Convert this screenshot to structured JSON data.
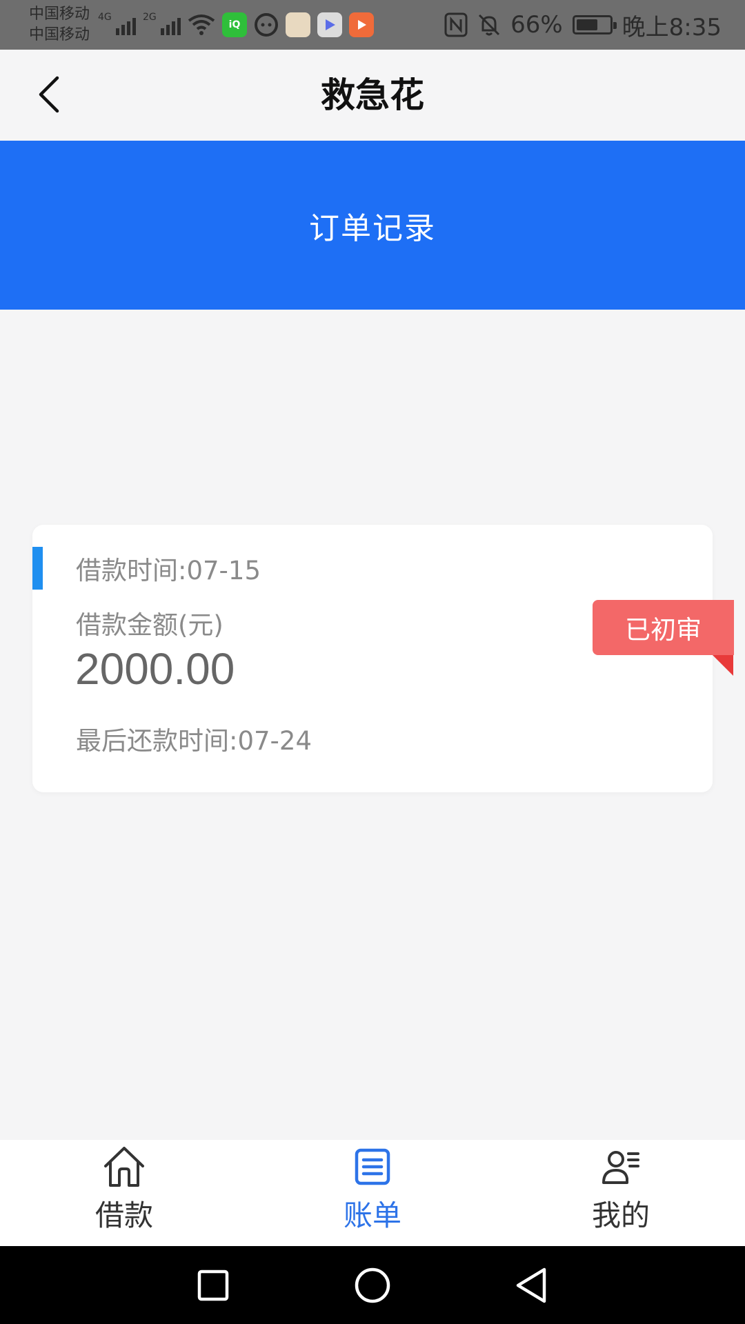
{
  "status_bar": {
    "carrier_1": "中国移动",
    "carrier_2": "中国移动",
    "network_1": "4G",
    "network_2": "2G",
    "battery_percent": "66%",
    "battery_level": 0.66,
    "time": "晚上8:35",
    "icons": [
      "signal-icon",
      "wifi-icon",
      "iqiyi-app-icon",
      "chat-app-icon",
      "bear-app-icon",
      "video-app-icon",
      "play-app-icon",
      "nfc-icon",
      "bell-muted-icon",
      "battery-icon"
    ]
  },
  "header": {
    "title": "救急花",
    "back_icon": "chevron-left-icon"
  },
  "banner": {
    "title": "订单记录",
    "color": "#1e6ff5"
  },
  "order": {
    "loan_time": "借款时间:07-15",
    "amount_label": "借款金额(元)",
    "amount": "2000.00",
    "due_time": "最后还款时间:07-24",
    "status": "已初审",
    "status_color": "#f36868"
  },
  "tabs": [
    {
      "label": "借款",
      "icon": "home-icon",
      "active": false
    },
    {
      "label": "账单",
      "icon": "bill-icon",
      "active": true
    },
    {
      "label": "我的",
      "icon": "profile-icon",
      "active": false
    }
  ],
  "accent_color": "#2d73e8",
  "system_nav": [
    "recent-apps-icon",
    "home-circle-icon",
    "back-triangle-icon"
  ]
}
